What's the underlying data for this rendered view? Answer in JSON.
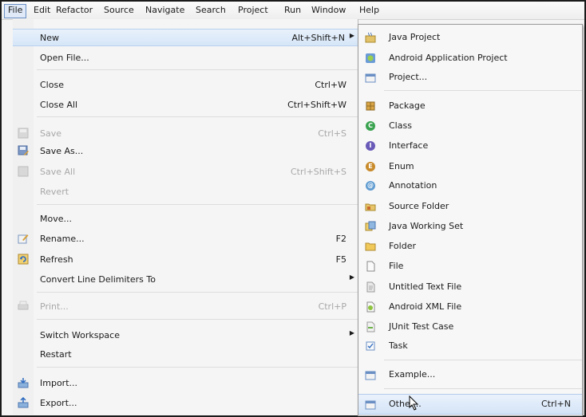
{
  "menubar": {
    "items": [
      "File",
      "Edit",
      "Refactor",
      "Source",
      "Navigate",
      "Search",
      "Project",
      "Run",
      "Window",
      "Help"
    ]
  },
  "file_menu": {
    "items": [
      {
        "label": "New",
        "shortcut": "Alt+Shift+N",
        "submenu": true
      },
      {
        "label": "Open File..."
      },
      {
        "label": "Close",
        "shortcut": "Ctrl+W"
      },
      {
        "label": "Close All",
        "shortcut": "Ctrl+Shift+W"
      },
      {
        "label": "Save",
        "shortcut": "Ctrl+S",
        "disabled": true
      },
      {
        "label": "Save As..."
      },
      {
        "label": "Save All",
        "shortcut": "Ctrl+Shift+S",
        "disabled": true
      },
      {
        "label": "Revert",
        "disabled": true
      },
      {
        "label": "Move..."
      },
      {
        "label": "Rename...",
        "shortcut": "F2"
      },
      {
        "label": "Refresh",
        "shortcut": "F5"
      },
      {
        "label": "Convert Line Delimiters To",
        "submenu": true
      },
      {
        "label": "Print...",
        "shortcut": "Ctrl+P",
        "disabled": true
      },
      {
        "label": "Switch Workspace",
        "submenu": true
      },
      {
        "label": "Restart"
      },
      {
        "label": "Import..."
      },
      {
        "label": "Export..."
      }
    ]
  },
  "new_submenu": {
    "items": [
      {
        "label": "Java Project",
        "icon": "java-project-icon"
      },
      {
        "label": "Android Application Project",
        "icon": "android-project-icon"
      },
      {
        "label": "Project...",
        "icon": "project-icon"
      },
      {
        "label": "Package",
        "icon": "package-icon"
      },
      {
        "label": "Class",
        "icon": "class-icon"
      },
      {
        "label": "Interface",
        "icon": "interface-icon"
      },
      {
        "label": "Enum",
        "icon": "enum-icon"
      },
      {
        "label": "Annotation",
        "icon": "annotation-icon"
      },
      {
        "label": "Source Folder",
        "icon": "source-folder-icon"
      },
      {
        "label": "Java Working Set",
        "icon": "working-set-icon"
      },
      {
        "label": "Folder",
        "icon": "folder-icon"
      },
      {
        "label": "File",
        "icon": "file-icon"
      },
      {
        "label": "Untitled Text File",
        "icon": "text-file-icon"
      },
      {
        "label": "Android XML File",
        "icon": "android-xml-icon"
      },
      {
        "label": "JUnit Test Case",
        "icon": "junit-icon"
      },
      {
        "label": "Task",
        "icon": "task-icon"
      },
      {
        "label": "Example...",
        "icon": "example-icon"
      },
      {
        "label": "Other...",
        "shortcut": "Ctrl+N",
        "icon": "other-icon"
      }
    ]
  },
  "colors": {
    "highlight": "#d6e6f8",
    "accent": "#6a8fc4",
    "disabled": "#a8a8a8"
  }
}
